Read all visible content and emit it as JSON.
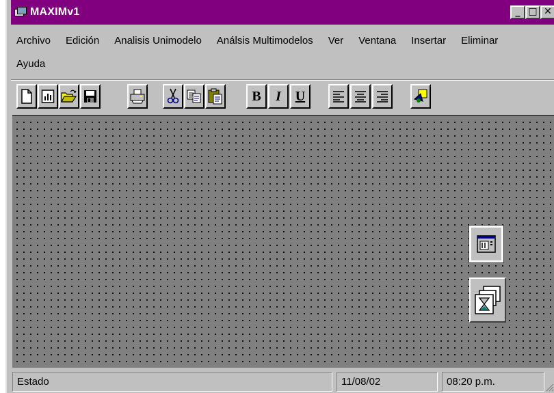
{
  "window": {
    "title": "MAXIMv1"
  },
  "window_controls": {
    "minimize": "_",
    "maximize": "□",
    "close": "✕"
  },
  "menu": {
    "items": [
      "Archivo",
      "Edición",
      "Analisis Unimodelo",
      "Análsis Multimodelos",
      "Ver",
      "Ventana",
      "Insertar",
      "Eliminar",
      "Ayuda"
    ]
  },
  "toolbar": {
    "buttons": [
      "new-icon",
      "chart-icon",
      "open-icon",
      "save-icon",
      "print-icon",
      "cut-icon",
      "copy-icon",
      "paste-icon",
      "bold",
      "italic",
      "underline",
      "align-left-icon",
      "align-center-icon",
      "align-right-icon",
      "shapes-icon"
    ],
    "bold_label": "B",
    "italic_label": "I",
    "underline_label": "U"
  },
  "statusbar": {
    "status": "Estado",
    "date": "11/08/02",
    "time": "08:20 p.m."
  },
  "colors": {
    "titlebar": "#800080",
    "face": "#c0c0c0",
    "workspace": "#808080"
  }
}
